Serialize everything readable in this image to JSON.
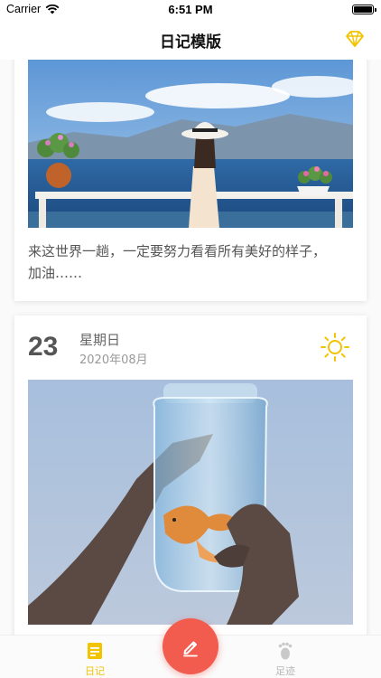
{
  "status_bar": {
    "carrier": "Carrier",
    "time": "6:51 PM",
    "battery_level": 1.0
  },
  "nav": {
    "title": "日记模版",
    "right_icon": "diamond-icon",
    "accent": "#f2c300"
  },
  "entries": [
    {
      "caption": "来这世界一趟，一定要努力看看所有美好的样子，加油……",
      "photo": "woman-in-hat-by-lake"
    },
    {
      "day": "23",
      "weekday": "星期日",
      "year_month": "2020年08月",
      "weather_icon": "sun-icon",
      "photo": "goldfish-in-jar"
    }
  ],
  "tab_bar": {
    "tabs": [
      {
        "label": "日记",
        "icon": "diary-icon",
        "active": true
      },
      {
        "label": "足迹",
        "icon": "footprint-icon",
        "active": false
      }
    ],
    "center_button_icon": "pen-icon",
    "center_button_color": "#f25c4f"
  }
}
